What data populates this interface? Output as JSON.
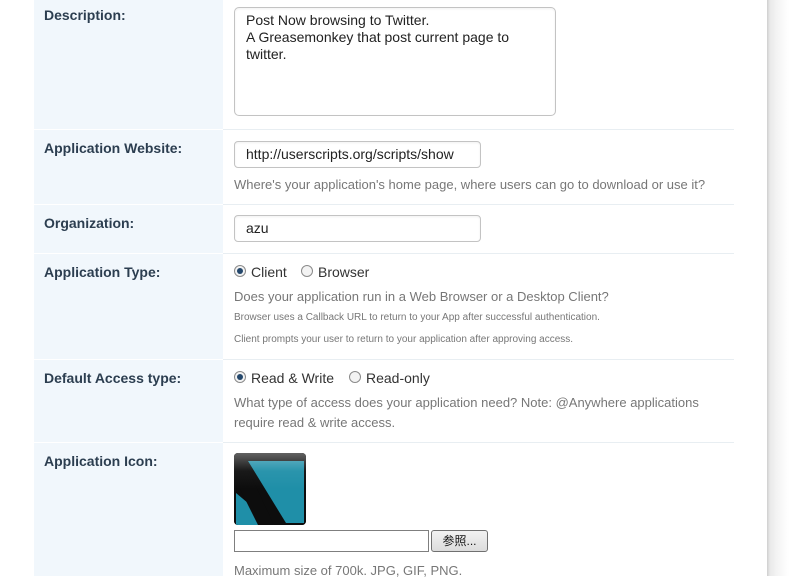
{
  "form": {
    "description": {
      "label": "Description:",
      "value": "Post Now browsing to Twitter.\nA Greasemonkey that post current page to\ntwitter."
    },
    "website": {
      "label": "Application Website:",
      "value": "http://userscripts.org/scripts/show",
      "hint": "Where's your application's home page, where users can go to download or use it?"
    },
    "organization": {
      "label": "Organization:",
      "value": "azu"
    },
    "app_type": {
      "label": "Application Type:",
      "options": [
        "Client",
        "Browser"
      ],
      "selected": "Client",
      "hint": "Does your application run in a Web Browser or a Desktop Client?",
      "note1": "Browser uses a Callback URL to return to your App after successful authentication.",
      "note2": "Client prompts your user to return to your application after approving access."
    },
    "access": {
      "label": "Default Access type:",
      "options": [
        "Read & Write",
        "Read-only"
      ],
      "selected": "Read & Write",
      "hint_line1": "What type of access does your application need? Note: @Anywhere applications",
      "hint_line2": "require read & write access."
    },
    "icon": {
      "label": "Application Icon:",
      "browse_label": "参照...",
      "file_value": "",
      "hint": "Maximum size of 700k. JPG, GIF, PNG."
    }
  },
  "colors": {
    "label_col_bg": "#f1f7fc",
    "label_text": "#2c3e50",
    "hint_text": "#777777",
    "radio_dot": "#24476b",
    "icon_teal": "#1f8fa8"
  }
}
